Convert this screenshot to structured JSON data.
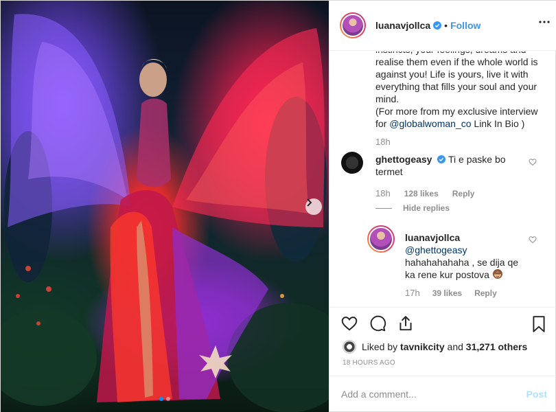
{
  "header": {
    "username": "luanavjollca",
    "follow_label": "Follow"
  },
  "caption": {
    "text": "instincts, your feelings, dreams and realise them even if the whole world is against you! Life is yours, live it with everything that fills your soul and your mind.\n(For more from my exclusive interview for ",
    "mention": "@globalwoman_co",
    "text_after": " Link In Bio )",
    "time": "18h"
  },
  "comments": [
    {
      "username": "ghettogeasy",
      "text": "Ti e paske bo termet",
      "time": "18h",
      "likes": "128 likes",
      "reply_label": "Reply",
      "hide_replies_label": "Hide replies"
    },
    {
      "username": "luanavjollca",
      "mention": "@ghettogeasy",
      "text": "hahahahahaha , se dija qe ka rene kur postova",
      "time": "17h",
      "likes": "39 likes",
      "reply_label": "Reply"
    }
  ],
  "likes": {
    "prefix": "Liked by",
    "liker": "tavnikcity",
    "connector": "and",
    "others": "31,271 others"
  },
  "timestamp": "18 HOURS AGO",
  "add_comment": {
    "placeholder": "Add a comment...",
    "post_label": "Post"
  },
  "colors": {
    "link_blue": "#3897f0",
    "verified_blue": "#3897f0",
    "muted": "#8e8e8e"
  },
  "icons": [
    "verified-badge-icon",
    "more-options-icon",
    "heart-icon",
    "comment-icon",
    "share-icon",
    "bookmark-icon",
    "chevron-right-icon"
  ]
}
